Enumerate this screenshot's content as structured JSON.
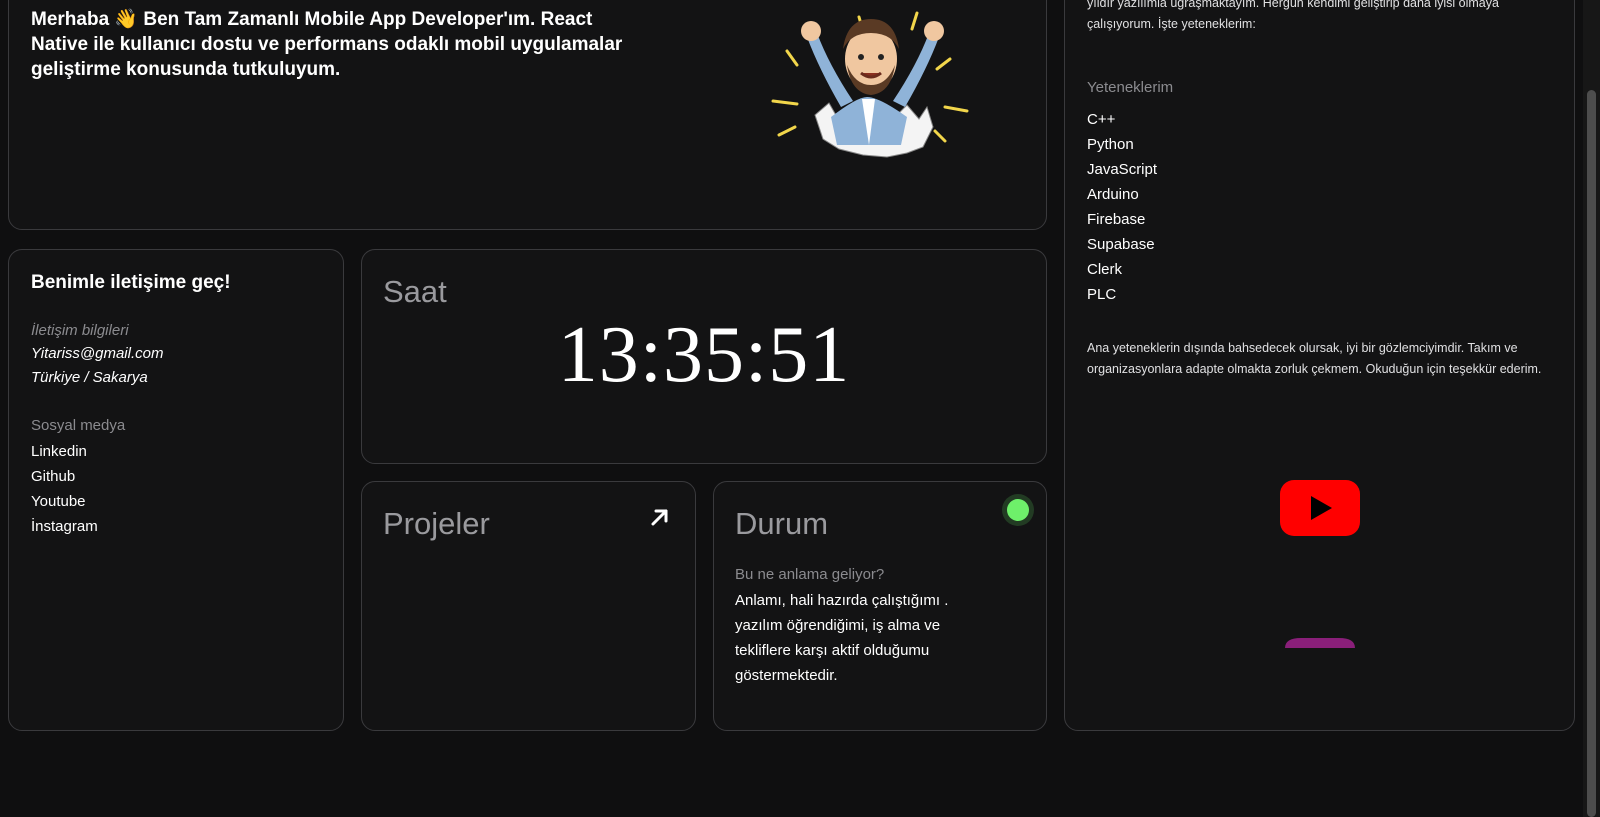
{
  "intro": {
    "line1": "Merhaba 👋 Ben Tam Zamanlı Mobile App Developer'ım. React",
    "line2": "Native ile kullanıcı dostu ve performans odaklı mobil uygulamalar",
    "line3": "geliştirme konusunda tutkuluyum."
  },
  "contact": {
    "title": "Benimle iletişime geç!",
    "info_label": "İletişim bilgileri",
    "email": "Yitariss@gmail.com",
    "location": "Türkiye / Sakarya",
    "social_label": "Sosyal medya",
    "social": [
      "Linkedin",
      "Github",
      "Youtube",
      "İnstagram"
    ]
  },
  "clock": {
    "title": "Saat",
    "time": "13:35:51"
  },
  "projects": {
    "title": "Projeler",
    "icon": "arrow-up-right-icon"
  },
  "status": {
    "title": "Durum",
    "indicator_color": "#6ef06a",
    "question": "Bu ne anlama geliyor?",
    "body": "Anlamı, hali hazırda çalıştığımı . yazılım öğrendiğimi, iş alma ve tekliflere karşı aktif olduğumu göstermektedir."
  },
  "about": {
    "top_line1": "yıldır yazılımla uğraşmaktayım. Hergün kendimi geliştirip daha iyisi olmaya",
    "top_line2": "çalışıyorum. İşte yeteneklerim:",
    "skills_label": "Yeteneklerim",
    "skills": [
      "C++",
      "Python",
      "JavaScript",
      "Arduino",
      "Firebase",
      "Supabase",
      "Clerk",
      "PLC"
    ],
    "bottom": "Ana yeteneklerin dışında bahsedecek olursak, iyi bir gözlemciyimdir. Takım ve organizasyonlara adapte olmakta zorluk çekmem. Okuduğun için teşekkür ederim.",
    "icons": [
      "youtube-icon",
      "instagram-icon"
    ]
  },
  "colors": {
    "background": "#0f0f10",
    "card": "#131314",
    "border": "#3a3a3d",
    "muted": "#9a9a9e",
    "youtube_red": "#ff0000",
    "instagram_purple": "#8a1f7a"
  }
}
